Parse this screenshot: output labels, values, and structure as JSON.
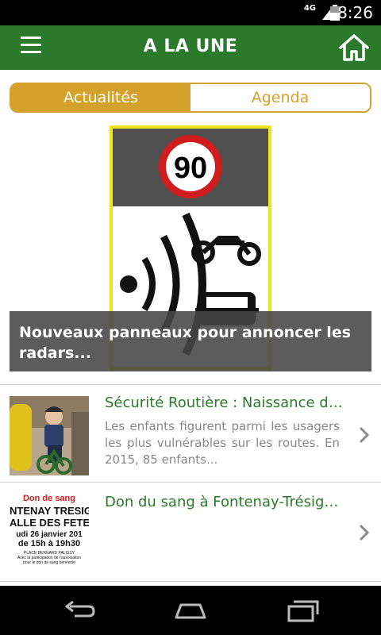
{
  "status_bar": {
    "network": "4G",
    "time": "8:26"
  },
  "app_bar": {
    "title": "A LA UNE",
    "menu_icon": "hamburger-menu-icon",
    "home_icon": "home-icon"
  },
  "tabs": [
    {
      "label": "Actualités",
      "active": true
    },
    {
      "label": "Agenda",
      "active": false
    }
  ],
  "featured": {
    "title": "Nouveaux panneaux pour annoncer les radars...",
    "image_text": "90"
  },
  "news_items": [
    {
      "title": "Sécurité Routière : Naissance d'...",
      "excerpt": "Les enfants figurent parmi les usagers les plus vulnérables sur les routes. En 2015, 85 enfants..."
    },
    {
      "title": "Don du sang à Fontenay-Trésign...",
      "excerpt": "",
      "thumb_lines": [
        "Don de sang",
        "NTENAY TRESIG",
        "ALLE DES FETE",
        "udi 26 janvier 201",
        "de 15h à 19h30",
        "PLACE BERNARD PALISSY",
        "Avec la participation de l'association",
        "pour le don de sang bénévole"
      ]
    }
  ],
  "colors": {
    "primary_green": "#2b7a2b",
    "accent_gold": "#d4a12a",
    "overlay": "#464646"
  }
}
